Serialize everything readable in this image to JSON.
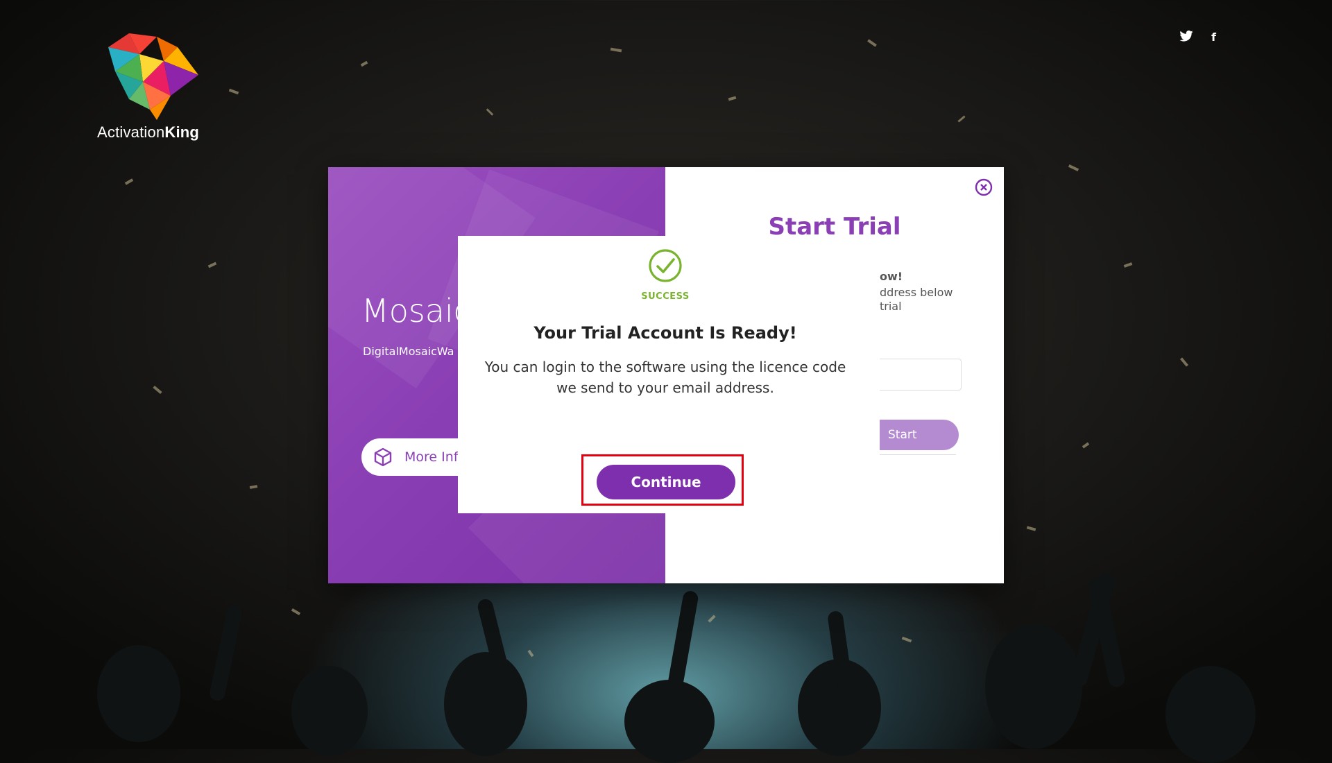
{
  "logo": {
    "brand_light": "Activation",
    "brand_bold": "King"
  },
  "social": {
    "twitter_icon": "twitter-icon",
    "facebook_label": "f"
  },
  "modal": {
    "left": {
      "product_title": "Mosaic",
      "product_url": "DigitalMosaicWa",
      "more_info_label": "More Inf",
      "more_info_icon": "cube-icon"
    },
    "right": {
      "title": "Start Trial",
      "text_line1": "ow!",
      "text_line2": "ddress below",
      "text_line3": "trial",
      "start_label": "Start",
      "close_icon": "close-icon"
    }
  },
  "dialog": {
    "status": "SUCCESS",
    "title": "Your Trial Account Is Ready!",
    "message": "You can login to the software using the licence code we send to your email address.",
    "continue_label": "Continue",
    "success_icon": "checkmark-circle-icon"
  },
  "colors": {
    "brand_purple": "#8b3fb4",
    "button_purple": "#7e2fad",
    "success_green": "#7ab32e",
    "highlight_red": "#e5000f"
  }
}
